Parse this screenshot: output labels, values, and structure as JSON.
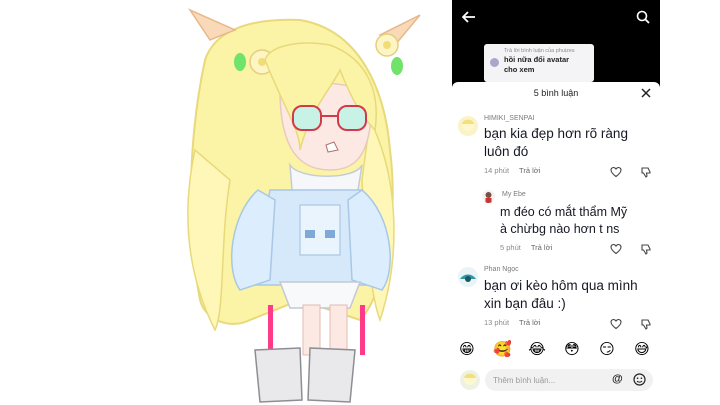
{
  "reply_card": {
    "header": "Trả lời bình luận của phuizes",
    "message_line1": "hồi nữa đổi avatar",
    "message_line2": "cho xem"
  },
  "sheet": {
    "title": "5 bình luận"
  },
  "comments": [
    {
      "username": "HIMIKI_SENPAI",
      "text_line1": "bạn kia đẹp hơn rõ ràng",
      "text_line2": "luôn đó",
      "time": "14 phút",
      "reply_label": "Trả lời"
    },
    {
      "username": "My Ebe",
      "text_line1": "m đéo có mắt thẩm Mỹ",
      "text_line2": "à chừbg nào hơn t ns",
      "time": "5 phút",
      "reply_label": "Trả lời"
    },
    {
      "username": "Phan Ngọc",
      "text_line1": "bạn ơi kèo hôm qua mình",
      "text_line2": "xin bạn đâu :)",
      "time": "13 phút",
      "reply_label": "Trả lời"
    }
  ],
  "emojis": [
    "😁",
    "🥰",
    "😂",
    "😳",
    "😏",
    "😅"
  ],
  "composer": {
    "placeholder": "Thêm bình luận...",
    "at_label": "@"
  },
  "icons": {
    "back": "back-arrow-icon",
    "search": "search-icon",
    "close": "close-icon",
    "like": "heart-icon",
    "dislike": "thumbs-down-icon",
    "emoji": "emoji-face-icon"
  }
}
